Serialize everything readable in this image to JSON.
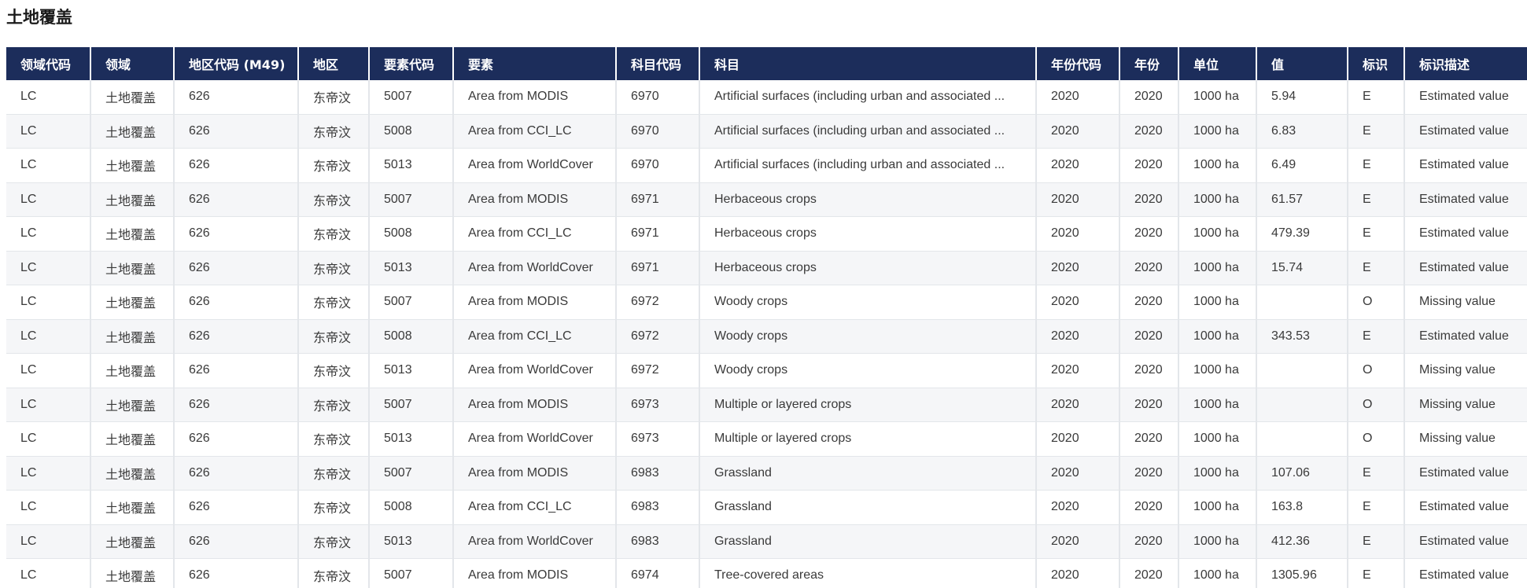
{
  "page": {
    "title": "土地覆盖"
  },
  "table": {
    "headers": [
      "领域代码",
      "领域",
      "地区代码 (M49)",
      "地区",
      "要素代码",
      "要素",
      "科目代码",
      "科目",
      "年份代码",
      "年份",
      "单位",
      "值",
      "标识",
      "标识描述"
    ],
    "rows": [
      [
        "LC",
        "土地覆盖",
        "626",
        "东帝汶",
        "5007",
        "Area from MODIS",
        "6970",
        "Artificial surfaces (including urban and associated ...",
        "2020",
        "2020",
        "1000 ha",
        "5.94",
        "E",
        "Estimated value"
      ],
      [
        "LC",
        "土地覆盖",
        "626",
        "东帝汶",
        "5008",
        "Area from CCI_LC",
        "6970",
        "Artificial surfaces (including urban and associated ...",
        "2020",
        "2020",
        "1000 ha",
        "6.83",
        "E",
        "Estimated value"
      ],
      [
        "LC",
        "土地覆盖",
        "626",
        "东帝汶",
        "5013",
        "Area from WorldCover",
        "6970",
        "Artificial surfaces (including urban and associated ...",
        "2020",
        "2020",
        "1000 ha",
        "6.49",
        "E",
        "Estimated value"
      ],
      [
        "LC",
        "土地覆盖",
        "626",
        "东帝汶",
        "5007",
        "Area from MODIS",
        "6971",
        "Herbaceous crops",
        "2020",
        "2020",
        "1000 ha",
        "61.57",
        "E",
        "Estimated value"
      ],
      [
        "LC",
        "土地覆盖",
        "626",
        "东帝汶",
        "5008",
        "Area from CCI_LC",
        "6971",
        "Herbaceous crops",
        "2020",
        "2020",
        "1000 ha",
        "479.39",
        "E",
        "Estimated value"
      ],
      [
        "LC",
        "土地覆盖",
        "626",
        "东帝汶",
        "5013",
        "Area from WorldCover",
        "6971",
        "Herbaceous crops",
        "2020",
        "2020",
        "1000 ha",
        "15.74",
        "E",
        "Estimated value"
      ],
      [
        "LC",
        "土地覆盖",
        "626",
        "东帝汶",
        "5007",
        "Area from MODIS",
        "6972",
        "Woody crops",
        "2020",
        "2020",
        "1000 ha",
        "",
        "O",
        "Missing value"
      ],
      [
        "LC",
        "土地覆盖",
        "626",
        "东帝汶",
        "5008",
        "Area from CCI_LC",
        "6972",
        "Woody crops",
        "2020",
        "2020",
        "1000 ha",
        "343.53",
        "E",
        "Estimated value"
      ],
      [
        "LC",
        "土地覆盖",
        "626",
        "东帝汶",
        "5013",
        "Area from WorldCover",
        "6972",
        "Woody crops",
        "2020",
        "2020",
        "1000 ha",
        "",
        "O",
        "Missing value"
      ],
      [
        "LC",
        "土地覆盖",
        "626",
        "东帝汶",
        "5007",
        "Area from MODIS",
        "6973",
        "Multiple or layered crops",
        "2020",
        "2020",
        "1000 ha",
        "",
        "O",
        "Missing value"
      ],
      [
        "LC",
        "土地覆盖",
        "626",
        "东帝汶",
        "5013",
        "Area from WorldCover",
        "6973",
        "Multiple or layered crops",
        "2020",
        "2020",
        "1000 ha",
        "",
        "O",
        "Missing value"
      ],
      [
        "LC",
        "土地覆盖",
        "626",
        "东帝汶",
        "5007",
        "Area from MODIS",
        "6983",
        "Grassland",
        "2020",
        "2020",
        "1000 ha",
        "107.06",
        "E",
        "Estimated value"
      ],
      [
        "LC",
        "土地覆盖",
        "626",
        "东帝汶",
        "5008",
        "Area from CCI_LC",
        "6983",
        "Grassland",
        "2020",
        "2020",
        "1000 ha",
        "163.8",
        "E",
        "Estimated value"
      ],
      [
        "LC",
        "土地覆盖",
        "626",
        "东帝汶",
        "5013",
        "Area from WorldCover",
        "6983",
        "Grassland",
        "2020",
        "2020",
        "1000 ha",
        "412.36",
        "E",
        "Estimated value"
      ],
      [
        "LC",
        "土地覆盖",
        "626",
        "东帝汶",
        "5007",
        "Area from MODIS",
        "6974",
        "Tree-covered areas",
        "2020",
        "2020",
        "1000 ha",
        "1305.96",
        "E",
        "Estimated value"
      ]
    ]
  },
  "colors": {
    "header_bg": "#1c2d5b",
    "header_text": "#ffffff",
    "row_alt_bg": "#f5f6f8",
    "grid_line": "#e3e6ea"
  }
}
